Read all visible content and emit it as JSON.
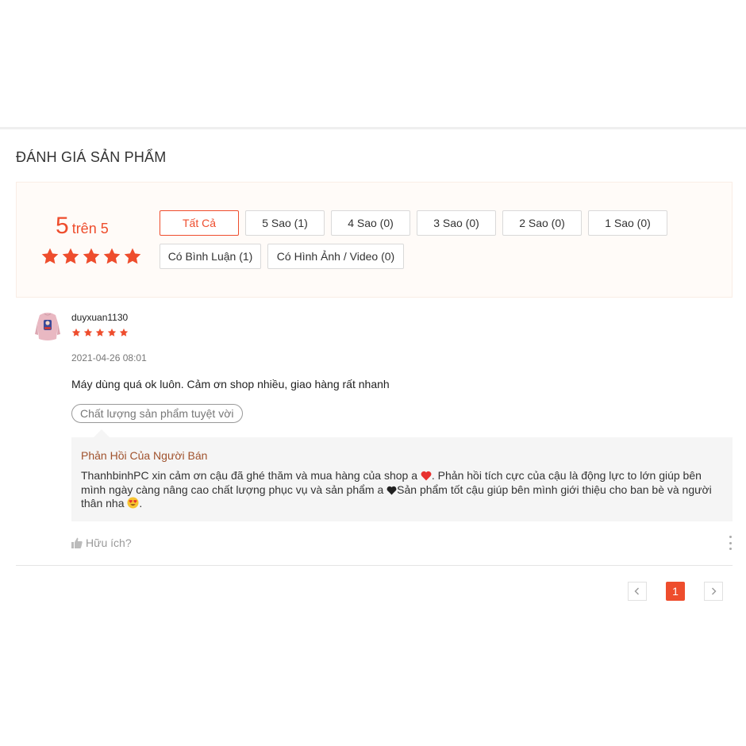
{
  "section_title": "ĐÁNH GIÁ SẢN PHẨM",
  "overview": {
    "score_value": "5",
    "score_suffix": "trên 5",
    "rating_stars": 5,
    "filters": [
      {
        "label": "Tất Cả",
        "active": true
      },
      {
        "label": "5 Sao (1)",
        "active": false
      },
      {
        "label": "4 Sao (0)",
        "active": false
      },
      {
        "label": "3 Sao (0)",
        "active": false
      },
      {
        "label": "2 Sao (0)",
        "active": false
      },
      {
        "label": "1 Sao (0)",
        "active": false
      },
      {
        "label": "Có Bình Luận (1)",
        "active": false
      },
      {
        "label": "Có Hình Ảnh / Video (0)",
        "active": false
      }
    ]
  },
  "review": {
    "username": "duyxuan1130",
    "rating_stars": 5,
    "timestamp": "2021-04-26 08:01",
    "comment": "Máy dùng quá ok luôn. Cảm ơn shop nhiều, giao hàng rất nhanh",
    "tag": "Chất lượng sản phẩm tuyệt vời",
    "seller_reply": {
      "title": "Phản Hồi Của Người Bán",
      "text_1": "ThanhbinhPC xin cảm ơn cậu đã ghé thăm và mua hàng của shop a ",
      "text_2": ". Phản hồi tích cực của cậu là động lực to lớn giúp bên mình ngày càng nâng cao chất lượng phục vụ và sản phẩm a ",
      "text_3": "Sản phẩm tốt cậu giúp bên mình giới thiệu cho ban bè và người thân nha ",
      "text_4": "."
    },
    "helpful_label": "Hữu ích?"
  },
  "pagination": {
    "current_page": "1"
  },
  "colors": {
    "accent": "#ee4d2d",
    "overview_bg": "#fffbf8",
    "reply_title": "#a0522d"
  },
  "icons": [
    "star-icon",
    "thumbs-up-icon",
    "more-vertical-icon",
    "chevron-left-icon",
    "chevron-right-icon",
    "red-heart-emoji",
    "black-heart-emoji",
    "heart-eyes-emoji"
  ]
}
